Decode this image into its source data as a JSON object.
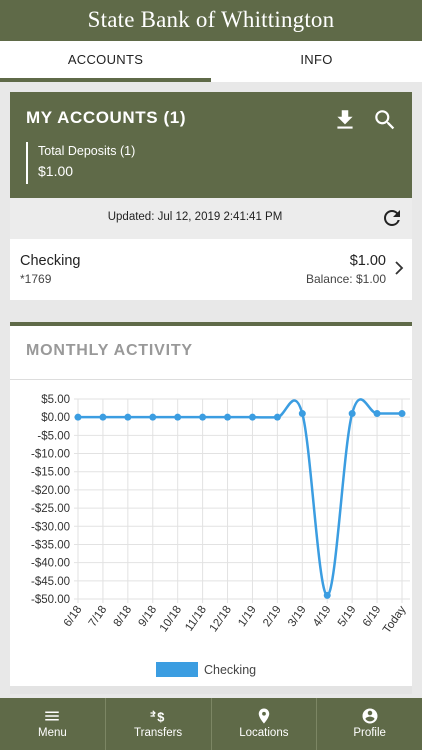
{
  "app": {
    "title": "State Bank of Whittington"
  },
  "tabs": [
    {
      "label": "ACCOUNTS",
      "active": true
    },
    {
      "label": "INFO",
      "active": false
    }
  ],
  "accounts_card": {
    "title": "MY ACCOUNTS (1)",
    "total_label": "Total Deposits (1)",
    "total_value": "$1.00",
    "download_icon": "download-icon",
    "search_icon": "search-icon"
  },
  "updated": {
    "label": "Updated:",
    "value": "Jul 12, 2019 2:41:41 PM",
    "icon": "refresh-icon"
  },
  "account": {
    "name": "Checking",
    "number": "*1769",
    "amount": "$1.00",
    "balance": "Balance: $1.00"
  },
  "activity": {
    "title": "MONTHLY ACTIVITY"
  },
  "chart_data": {
    "type": "line",
    "categories": [
      "6/18",
      "7/18",
      "8/18",
      "9/18",
      "10/18",
      "11/18",
      "12/18",
      "1/19",
      "2/19",
      "3/19",
      "4/19",
      "5/19",
      "6/19",
      "Today"
    ],
    "series": [
      {
        "name": "Checking",
        "color": "#3b9de1",
        "values": [
          0,
          0,
          0,
          0,
          0,
          0,
          0,
          0,
          0,
          1,
          -49,
          1,
          1,
          1
        ]
      }
    ],
    "y_ticks": [
      "$5.00",
      "$0.00",
      "-$5.00",
      "-$10.00",
      "-$15.00",
      "-$20.00",
      "-$25.00",
      "-$30.00",
      "-$35.00",
      "-$40.00",
      "-$45.00",
      "-$50.00"
    ],
    "ylim": [
      -50,
      5
    ],
    "grid": true,
    "legend": "bottom"
  },
  "nav": [
    {
      "label": "Menu",
      "icon": "menu-icon"
    },
    {
      "label": "Transfers",
      "icon": "transfers-icon"
    },
    {
      "label": "Locations",
      "icon": "location-pin-icon"
    },
    {
      "label": "Profile",
      "icon": "profile-icon"
    }
  ],
  "colors": {
    "brand": "#5f6a48",
    "line": "#3b9de1"
  }
}
